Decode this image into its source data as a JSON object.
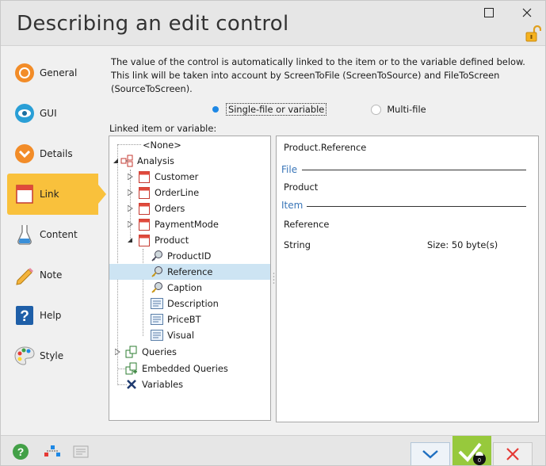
{
  "window": {
    "title": "Describing an edit control",
    "maximize_icon": "maximize-icon",
    "close_icon": "close-icon"
  },
  "sidebar": {
    "items": [
      {
        "label": "General",
        "icon": "general-icon",
        "active": false
      },
      {
        "label": "GUI",
        "icon": "eye-icon",
        "active": false
      },
      {
        "label": "Details",
        "icon": "chevron-down-circle-icon",
        "active": false
      },
      {
        "label": "Link",
        "icon": "link-table-icon",
        "active": true
      },
      {
        "label": "Content",
        "icon": "flask-icon",
        "active": false
      },
      {
        "label": "Note",
        "icon": "pencil-icon",
        "active": false
      },
      {
        "label": "Help",
        "icon": "help-icon",
        "active": false
      },
      {
        "label": "Style",
        "icon": "palette-icon",
        "active": false
      }
    ]
  },
  "main": {
    "description_lines": [
      "The value of the control is automatically linked to the item or to the variable defined below.",
      "This link will be taken into account by ScreenToFile (ScreenToSource) and FileToScreen",
      "(SourceToScreen)."
    ],
    "radio_single": "Single-file or variable",
    "radio_multi": "Multi-file",
    "linked_label": "Linked item or variable:",
    "tree": {
      "none": "<None>",
      "analysis": "Analysis",
      "files": [
        "Customer",
        "OrderLine",
        "Orders",
        "PaymentMode",
        "Product"
      ],
      "product_items": [
        "ProductID",
        "Reference",
        "Caption",
        "Description",
        "PriceBT",
        "Visual"
      ],
      "queries": "Queries",
      "embedded_queries": "Embedded Queries",
      "variables": "Variables"
    },
    "detail": {
      "path": "Product.Reference",
      "file_header": "File",
      "file_value": "Product",
      "item_header": "Item",
      "item_value": "Reference",
      "type": "String",
      "size": "Size: 50 byte(s)"
    }
  },
  "colors": {
    "accent": "#f9c13c",
    "selection": "#cde4f3",
    "header_blue": "#3a76b8",
    "ok_green": "#97c93c",
    "radio_blue": "#1e88e5"
  },
  "bottom": {
    "ok_badge": "0"
  }
}
